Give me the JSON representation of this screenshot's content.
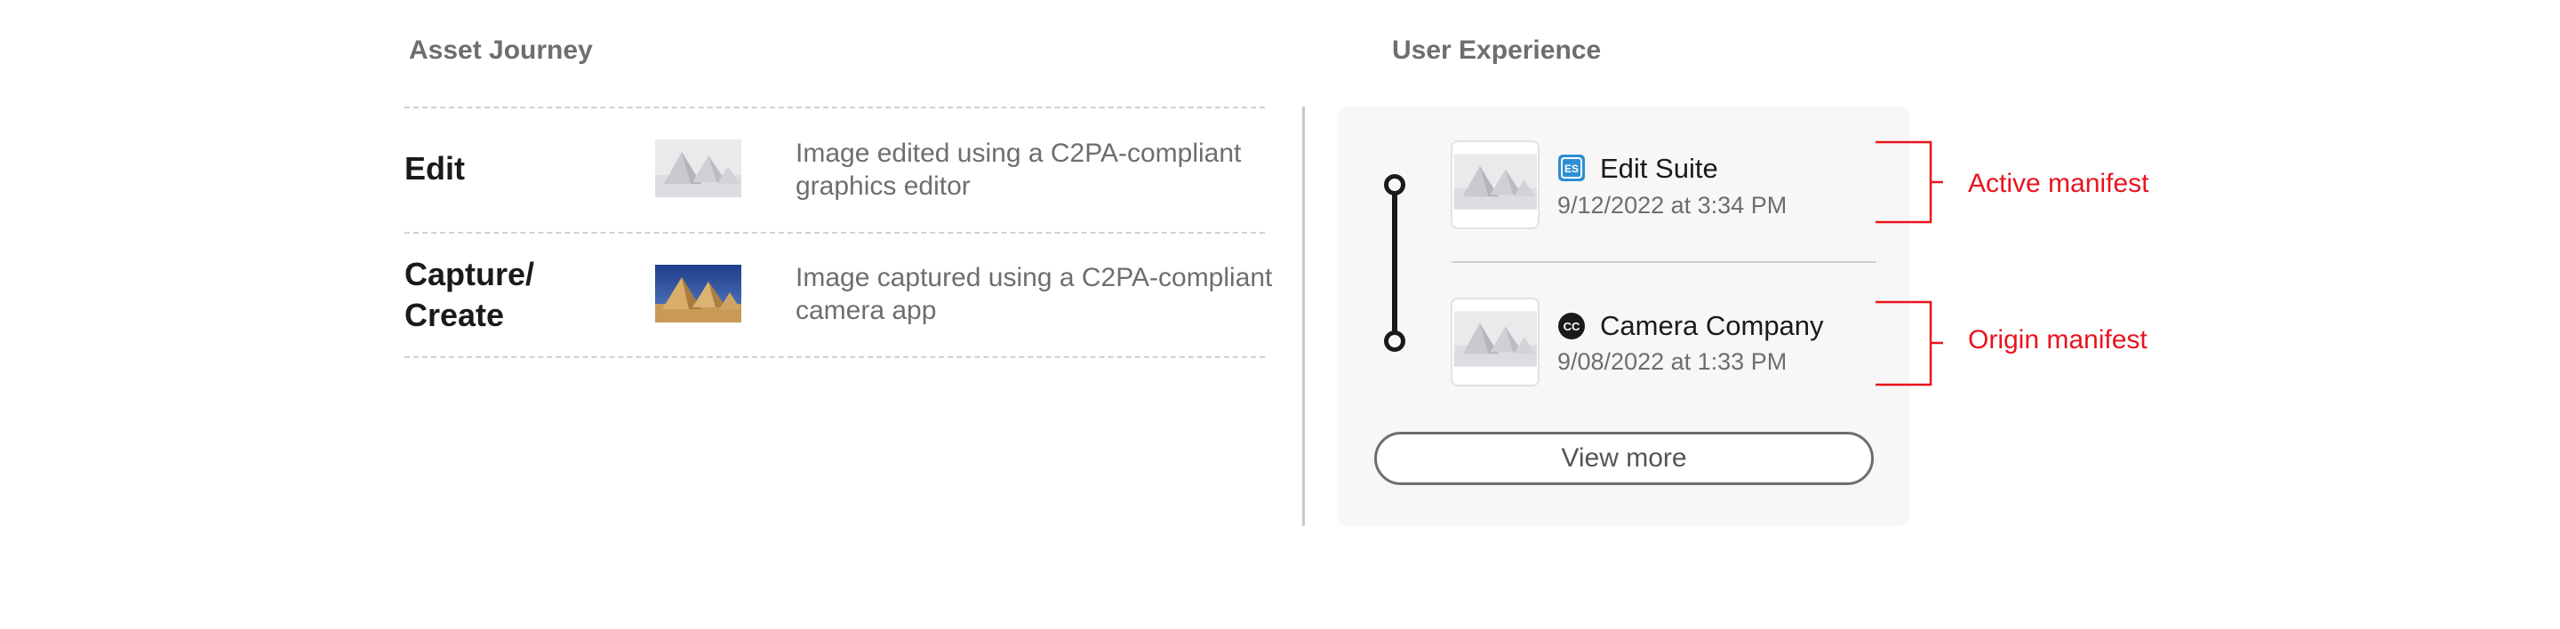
{
  "asset_journey": {
    "title": "Asset Journey",
    "steps": [
      {
        "label": "Edit",
        "image": "pyramids-snow-thumbnail",
        "description": "Image edited using a C2PA-compliant graphics editor"
      },
      {
        "label": "Capture/\nCreate",
        "image": "pyramids-desert-thumbnail",
        "description": "Image captured using a C2PA-compliant camera app"
      }
    ]
  },
  "user_experience": {
    "title": "User Experience",
    "manifests": [
      {
        "app_icon": "edit-suite-icon",
        "icon_text": "ES",
        "name": "Edit Suite",
        "date": "9/12/2022 at 3:34 PM",
        "annotation": "Active manifest"
      },
      {
        "app_icon": "camera-company-icon",
        "icon_text": "CC",
        "name": "Camera Company",
        "date": "9/08/2022 at 1:33 PM",
        "annotation": "Origin manifest"
      }
    ],
    "view_more_label": "View more"
  },
  "colors": {
    "annotation": "#e8141e",
    "edit_suite_icon": "#2d8fd5",
    "heading_gray": "#6e6e6e"
  }
}
